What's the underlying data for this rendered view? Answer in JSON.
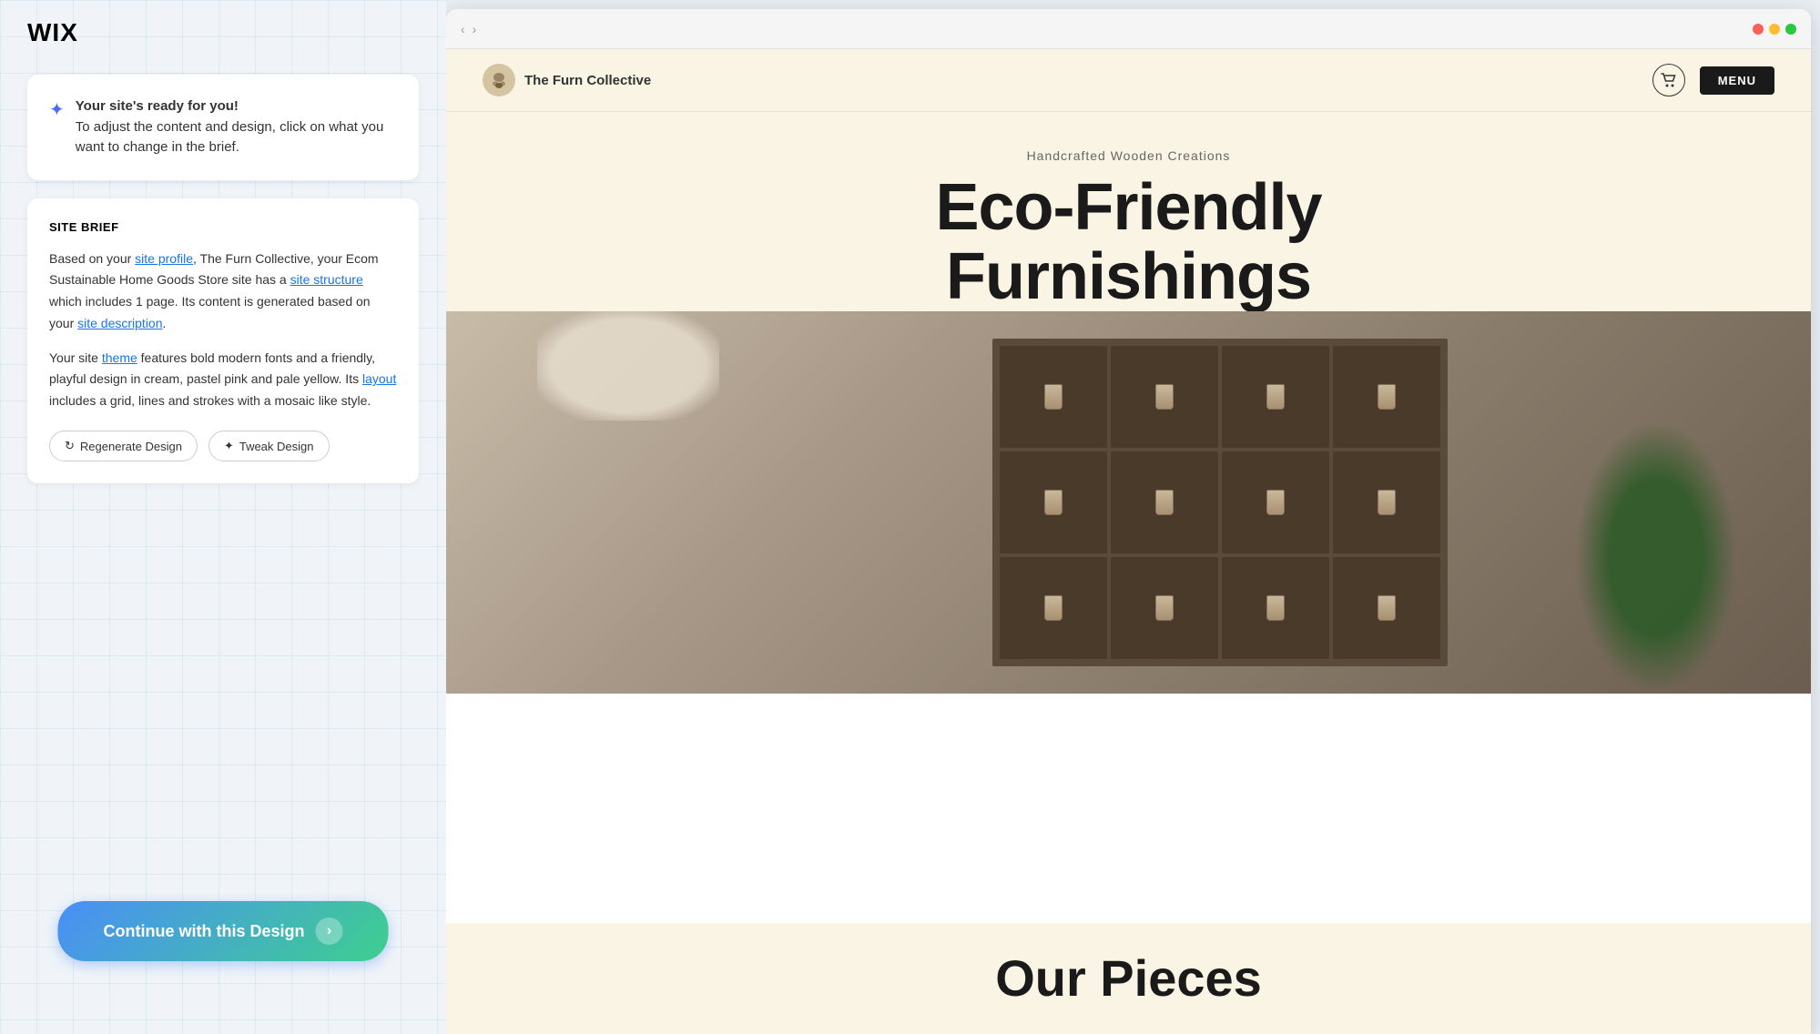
{
  "app": {
    "logo": "WIX"
  },
  "left_panel": {
    "ready_card": {
      "icon": "✦",
      "line1": "Your site's ready for you!",
      "line2": "To adjust the content and design, click on what you want to change in the brief."
    },
    "site_brief": {
      "title": "SITE BRIEF",
      "paragraph1_text": "Based on your ",
      "site_profile_link": "site profile",
      "paragraph1_cont": ", The Furn Collective, your Ecom Sustainable Home Goods Store site has a ",
      "site_structure_link": "site structure",
      "paragraph1_end": " which includes 1 page. Its content is generated based on your ",
      "site_description_link": "site description",
      "paragraph1_final": ".",
      "paragraph2_text": "Your site ",
      "theme_link": "theme",
      "paragraph2_cont": " features bold modern fonts and a friendly, playful design in cream, pastel pink and pale yellow. Its ",
      "layout_link": "layout",
      "paragraph2_end": " includes a grid, lines and strokes with a mosaic like style.",
      "regenerate_btn": "Regenerate Design",
      "tweak_btn": "Tweak Design"
    },
    "continue_btn": "Continue with this Design"
  },
  "website": {
    "header": {
      "logo_icon": "🐾",
      "logo_text": "The Furn Collective",
      "cart_icon": "🛒",
      "menu_btn": "MENU"
    },
    "hero": {
      "subtitle": "Handcrafted Wooden Creations",
      "title_line1": "Eco-Friendly",
      "title_line2": "Furnishings"
    },
    "bottom": {
      "title": "Our Pieces"
    }
  }
}
